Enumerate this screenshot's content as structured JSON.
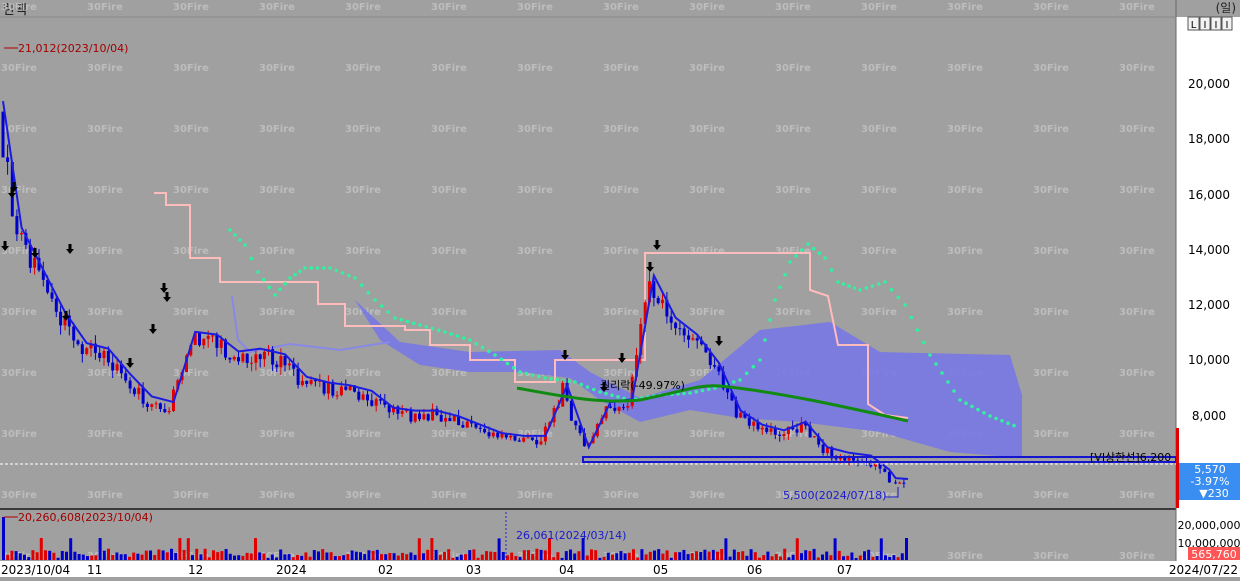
{
  "header": {
    "title": "한팩",
    "unit_label": "(일)",
    "period_buttons": [
      "L",
      "I",
      "I",
      "I"
    ]
  },
  "watermark": "30Fire",
  "price_axis": {
    "ticks": [
      "20,000",
      "18,000",
      "16,000",
      "14,000",
      "12,000",
      "10,000",
      "8,000"
    ]
  },
  "volume_axis": {
    "ticks": [
      "20,000,000",
      "10,000,000"
    ]
  },
  "date_axis": {
    "labels": [
      "2023/10/04",
      "11",
      "12",
      "2024",
      "02",
      "03",
      "04",
      "05",
      "06",
      "07",
      "2024/07/22"
    ]
  },
  "annotations": {
    "high_label": "21,012(2023/10/04)",
    "low_label": "5,500(2024/07/18)",
    "rights_label": "권리락(-49.97%)",
    "vi_label": "[VI상한선]6,200",
    "max_volume_label": "20,260,608(2023/10/04)",
    "min_volume_label": "26,061(2024/03/14)"
  },
  "current": {
    "price": "5,570",
    "change_pct": "-3.97%",
    "change_abs": "▼230",
    "volume": "565,760"
  },
  "colors": {
    "up": "#e00000",
    "down": "#0000cc",
    "ma": "#1c1ce0",
    "ma_long": "#108a10",
    "parabolic": "#33f0a0",
    "channel": "#ffbcbc",
    "cloud": "#7878e6",
    "background": "#a0a0a0"
  },
  "chart_data": {
    "type": "candlestick",
    "title": "한팩",
    "x_range": [
      "2023-10-04",
      "2024-07-22"
    ],
    "y_range": [
      5000,
      21500
    ],
    "period": "daily",
    "price_series": [
      {
        "date": "2023-10-04",
        "close": 19000
      },
      {
        "date": "2023-10-10",
        "close": 14500
      },
      {
        "date": "2023-10-17",
        "close": 13000
      },
      {
        "date": "2023-10-24",
        "close": 11500
      },
      {
        "date": "2023-10-31",
        "close": 10400
      },
      {
        "date": "2023-11-07",
        "close": 10200
      },
      {
        "date": "2023-11-14",
        "close": 9300
      },
      {
        "date": "2023-11-21",
        "close": 8500
      },
      {
        "date": "2023-11-28",
        "close": 8300
      },
      {
        "date": "2023-12-05",
        "close": 10800
      },
      {
        "date": "2023-12-12",
        "close": 10700
      },
      {
        "date": "2023-12-19",
        "close": 10100
      },
      {
        "date": "2023-12-26",
        "close": 10200
      },
      {
        "date": "2024-01-03",
        "close": 10000
      },
      {
        "date": "2024-01-10",
        "close": 9200
      },
      {
        "date": "2024-01-17",
        "close": 9000
      },
      {
        "date": "2024-01-24",
        "close": 8900
      },
      {
        "date": "2024-01-31",
        "close": 8700
      },
      {
        "date": "2024-02-07",
        "close": 8100
      },
      {
        "date": "2024-02-14",
        "close": 8000
      },
      {
        "date": "2024-02-21",
        "close": 8000
      },
      {
        "date": "2024-02-28",
        "close": 7800
      },
      {
        "date": "2024-03-06",
        "close": 7500
      },
      {
        "date": "2024-03-13",
        "close": 7200
      },
      {
        "date": "2024-03-20",
        "close": 7100
      },
      {
        "date": "2024-03-27",
        "close": 7100
      },
      {
        "date": "2024-04-03",
        "close": 8900
      },
      {
        "date": "2024-04-10",
        "close": 6700
      },
      {
        "date": "2024-04-17",
        "close": 8300
      },
      {
        "date": "2024-04-24",
        "close": 8400
      },
      {
        "date": "2024-05-01",
        "close": 12800
      },
      {
        "date": "2024-05-08",
        "close": 11300
      },
      {
        "date": "2024-05-15",
        "close": 10700
      },
      {
        "date": "2024-05-22",
        "close": 9700
      },
      {
        "date": "2024-05-29",
        "close": 8000
      },
      {
        "date": "2024-06-05",
        "close": 7500
      },
      {
        "date": "2024-06-12",
        "close": 7300
      },
      {
        "date": "2024-06-19",
        "close": 7600
      },
      {
        "date": "2024-06-26",
        "close": 6700
      },
      {
        "date": "2024-07-03",
        "close": 6500
      },
      {
        "date": "2024-07-10",
        "close": 6400
      },
      {
        "date": "2024-07-16",
        "close": 5900
      },
      {
        "date": "2024-07-18",
        "close": 5600
      },
      {
        "date": "2024-07-22",
        "close": 5570
      }
    ]
  }
}
